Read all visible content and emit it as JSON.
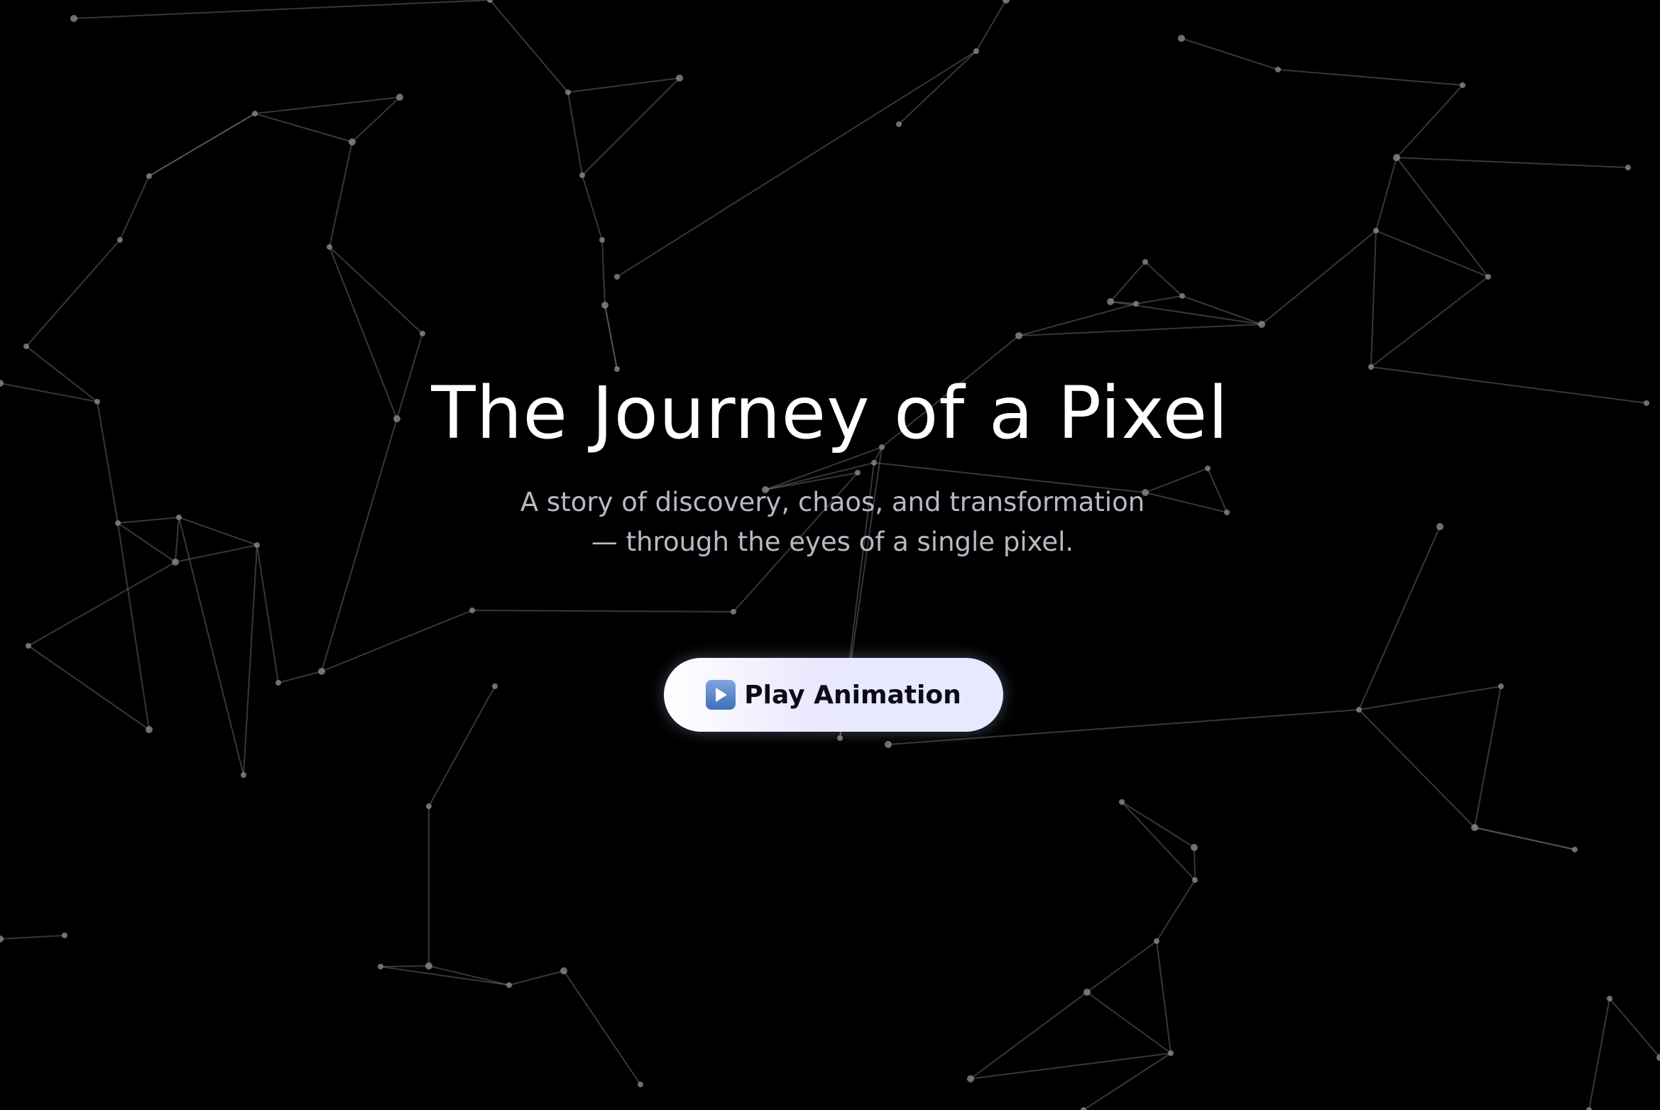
{
  "page": {
    "background_color": "#000000"
  },
  "hero": {
    "title": "The Journey of a Pixel",
    "subtitle": "A story of discovery, chaos, and transformation — through the eyes of a single pixel.",
    "play_button": {
      "icon": "play-icon",
      "label": "Play Animation"
    }
  },
  "colors": {
    "title": "#ffffff",
    "subtitle": "#b9b9c6",
    "button_background": "#ececfd",
    "button_text": "#0c0c18",
    "network_lines": "#7a7a7a",
    "network_nodes": "#8a8a8a"
  }
}
